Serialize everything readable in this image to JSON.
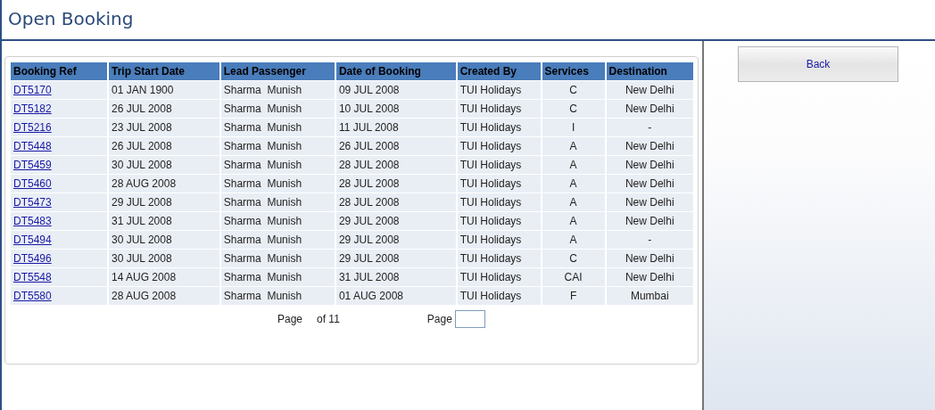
{
  "header": {
    "title": "Open Booking"
  },
  "table": {
    "columns": [
      "Booking Ref",
      "Trip Start Date",
      "Lead Passenger",
      "Date of Booking",
      "Created By",
      "Services",
      "Destination"
    ],
    "rows": [
      [
        "DT5170",
        "01 JAN 1900",
        "Sharma  Munish",
        "09 JUL 2008",
        "TUI Holidays",
        "C",
        "New Delhi"
      ],
      [
        "DT5182",
        "26 JUL 2008",
        "Sharma  Munish",
        "10 JUL 2008",
        "TUI Holidays",
        "C",
        "New Delhi"
      ],
      [
        "DT5216",
        "23 JUL 2008",
        "Sharma  Munish",
        "11 JUL 2008",
        "TUI Holidays",
        "I",
        "-"
      ],
      [
        "DT5448",
        "26 JUL 2008",
        "Sharma  Munish",
        "26 JUL 2008",
        "TUI Holidays",
        "A",
        "New Delhi"
      ],
      [
        "DT5459",
        "30 JUL 2008",
        "Sharma  Munish",
        "28 JUL 2008",
        "TUI Holidays",
        "A",
        "New Delhi"
      ],
      [
        "DT5460",
        "28 AUG 2008",
        "Sharma  Munish",
        "28 JUL 2008",
        "TUI Holidays",
        "A",
        "New Delhi"
      ],
      [
        "DT5473",
        "29 JUL 2008",
        "Sharma  Munish",
        "28 JUL 2008",
        "TUI Holidays",
        "A",
        "New Delhi"
      ],
      [
        "DT5483",
        "31 JUL 2008",
        "Sharma  Munish",
        "29 JUL 2008",
        "TUI Holidays",
        "A",
        "New Delhi"
      ],
      [
        "DT5494",
        "30 JUL 2008",
        "Sharma  Munish",
        "29 JUL 2008",
        "TUI Holidays",
        "A",
        "-"
      ],
      [
        "DT5496",
        "30 JUL 2008",
        "Sharma  Munish",
        "29 JUL 2008",
        "TUI Holidays",
        "C",
        "New Delhi"
      ],
      [
        "DT5548",
        "14 AUG 2008",
        "Sharma  Munish",
        "31 JUL 2008",
        "TUI Holidays",
        "CAI",
        "New Delhi"
      ],
      [
        "DT5580",
        "28 AUG 2008",
        "Sharma  Munish",
        "01 AUG 2008",
        "TUI Holidays",
        "F",
        "Mumbai"
      ]
    ]
  },
  "pager": {
    "page_label": "Page",
    "of_label": "of 11",
    "goto_label": "Page"
  },
  "back_button": {
    "label": "Back"
  }
}
